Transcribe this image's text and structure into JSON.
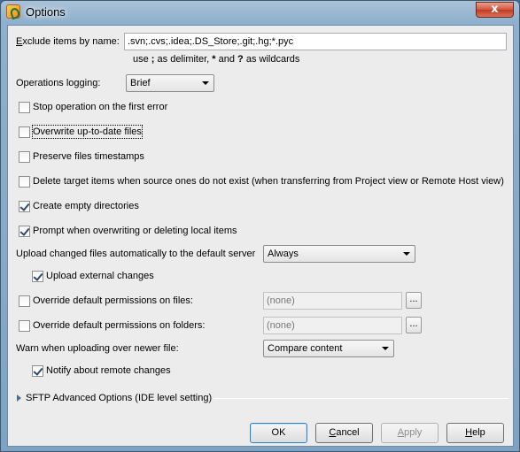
{
  "window": {
    "title": "Options",
    "close_glyph": "x"
  },
  "exclude": {
    "label": "Exclude items by name:",
    "value": ".svn;.cvs;.idea;.DS_Store;.git;.hg;*.pyc",
    "hint_prefix": "use ",
    "hint_semicolon": ";",
    "hint_mid": " as delimiter, ",
    "hint_star": "*",
    "hint_and": " and ",
    "hint_q": "?",
    "hint_suffix": " as wildcards"
  },
  "logging": {
    "label": "Operations logging:",
    "selected": "Brief"
  },
  "options": [
    {
      "label": "Stop operation on the first error",
      "checked": false
    },
    {
      "label": "Overwrite up-to-date files",
      "checked": false
    },
    {
      "label": "Preserve files timestamps",
      "checked": false
    },
    {
      "label": "Delete target items when source ones do not exist (when transferring from Project view or Remote Host view)",
      "checked": false
    },
    {
      "label": "Create empty directories",
      "checked": true
    },
    {
      "label": "Prompt when overwriting or deleting local items",
      "checked": true
    }
  ],
  "upload_changed": {
    "label": "Upload changed files automatically to the default server",
    "selected": "Always"
  },
  "upload_external": {
    "label": "Upload external changes",
    "checked": true
  },
  "perm_files": {
    "label": "Override default permissions on files:",
    "checked": false,
    "value": "(none)"
  },
  "perm_folders": {
    "label": "Override default permissions on folders:",
    "checked": false,
    "value": "(none)"
  },
  "ellipsis": "...",
  "warn": {
    "label": "Warn when uploading over newer file:",
    "selected": "Compare content"
  },
  "notify": {
    "label": "Notify about remote changes",
    "checked": true
  },
  "sftp": {
    "label": "SFTP Advanced Options (IDE level setting)"
  },
  "buttons": {
    "ok": "OK",
    "cancel": "Cancel",
    "apply": "Apply",
    "help": "Help"
  }
}
